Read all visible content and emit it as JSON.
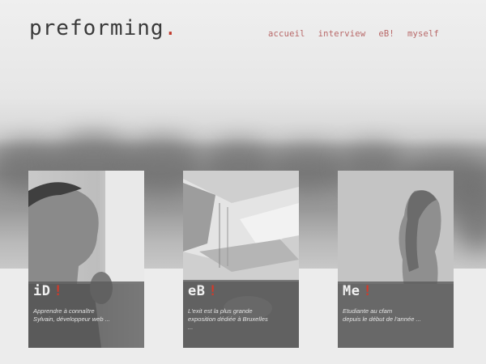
{
  "header": {
    "logo_text": "preforming",
    "logo_dot": ".",
    "nav": [
      "accueil",
      "interview",
      "eB!",
      "myself"
    ]
  },
  "cards": [
    {
      "title": "iD",
      "bang": "!",
      "desc_line1": "Apprendre à connaître",
      "desc_line2": "Sylvain, développeur web ..."
    },
    {
      "title": "eB",
      "bang": "!",
      "desc_line1": "L'exit est la plus grande",
      "desc_line2": "exposition dédiée à Bruxelles",
      "desc_line3": "..."
    },
    {
      "title": "Me",
      "bang": "!",
      "desc_line1": "Etudiante au cfam",
      "desc_line2": "depuis le début de l'année ..."
    }
  ],
  "colors": {
    "accent": "#c0392b",
    "nav": "#b86868",
    "overlay": "#5a5a5a"
  },
  "icons": [
    "person-photo",
    "architecture-photo",
    "woman-silhouette-photo"
  ]
}
